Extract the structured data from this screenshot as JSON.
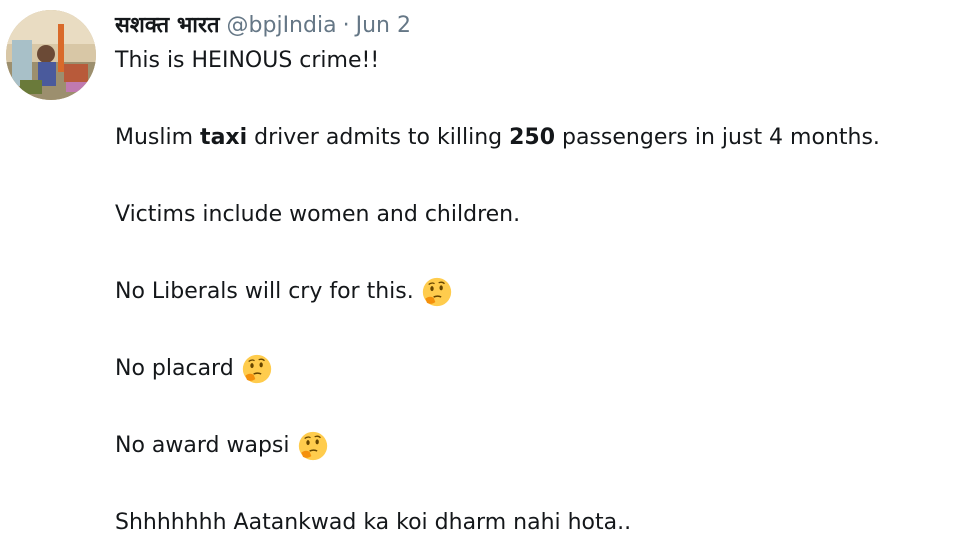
{
  "tweet": {
    "display_name": "सशक्त भारत",
    "handle": "@bpjIndia",
    "separator": "·",
    "date": "Jun 2",
    "line1": "This is HEINOUS crime!!",
    "line2_part1": "Muslim ",
    "line2_bold1": "taxi",
    "line2_part2": " driver admits to killing ",
    "line2_bold2": "250",
    "line2_part3": " passengers in just 4 months.",
    "line3": "Victims include women and children.",
    "line4": "No Liberals will cry for this.",
    "line5": "No placard",
    "line6": "No award wapsi",
    "line7": "Shhhhhhh Aatankwad ka koi dharm nahi hota.."
  },
  "icons": {
    "avatar": "avatar-photo",
    "emoji": "thinking-face-icon"
  },
  "colors": {
    "text": "#14171a",
    "secondary": "#657786",
    "emoji_face": "#ffcc4d"
  }
}
